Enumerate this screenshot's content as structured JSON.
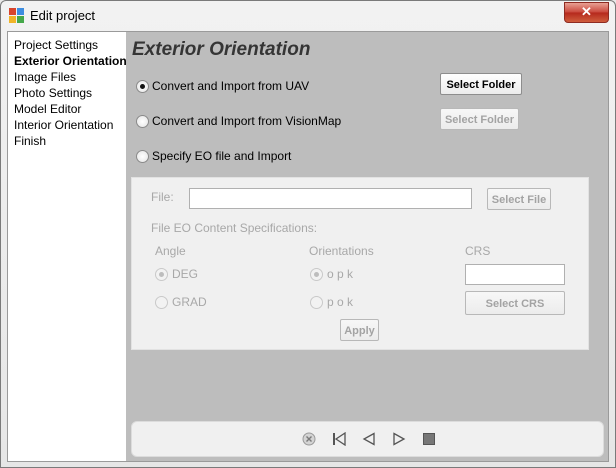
{
  "window": {
    "title": "Edit project",
    "close_glyph": "✕"
  },
  "sidebar": {
    "items": [
      {
        "label": "Project Settings",
        "active": false
      },
      {
        "label": "Exterior Orientation",
        "active": true
      },
      {
        "label": "Image Files",
        "active": false
      },
      {
        "label": "Photo Settings",
        "active": false
      },
      {
        "label": "Model Editor",
        "active": false
      },
      {
        "label": "Interior Orientation",
        "active": false
      },
      {
        "label": "Finish",
        "active": false
      }
    ]
  },
  "page": {
    "title": "Exterior Orientation",
    "options": [
      {
        "label": "Convert and Import from UAV",
        "selected": true,
        "button": "Select Folder",
        "button_enabled": true
      },
      {
        "label": "Convert and Import from VisionMap",
        "selected": false,
        "button": "Select Folder",
        "button_enabled": false
      },
      {
        "label": "Specify EO file and Import",
        "selected": false
      }
    ]
  },
  "eo_file": {
    "file_label": "File:",
    "file_value": "",
    "select_file_button": "Select File",
    "content_spec_label": "File EO Content Specifications:",
    "angle_header": "Angle",
    "angle_options": [
      "DEG",
      "GRAD"
    ],
    "orientations_header": "Orientations",
    "orientation_options": [
      "o p k",
      "p o k"
    ],
    "crs_header": "CRS",
    "crs_value": "",
    "select_crs_button": "Select CRS",
    "apply_button": "Apply"
  },
  "navigation": {
    "icons": [
      "cancel-icon",
      "first-step-icon",
      "previous-step-icon",
      "next-step-icon",
      "stop-icon"
    ]
  },
  "colors": {
    "panel_background": "#bdbdbd",
    "close_button": "#c9463a",
    "disabled_text": "#a8a8a8"
  }
}
